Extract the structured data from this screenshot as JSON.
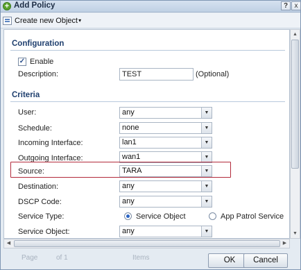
{
  "window": {
    "title": "Add Policy",
    "help_label": "?",
    "close_label": "x"
  },
  "toolbar": {
    "create_label": "Create new Object",
    "create_caret": "▾"
  },
  "configuration": {
    "title": "Configuration",
    "enable_label": "Enable",
    "enable_checked": true,
    "description_label": "Description:",
    "description_value": "TEST",
    "optional_label": "(Optional)"
  },
  "criteria": {
    "title": "Criteria",
    "rows": [
      {
        "label": "User:",
        "value": "any"
      },
      {
        "label": "Schedule:",
        "value": "none"
      },
      {
        "label": "Incoming Interface:",
        "value": "lan1"
      },
      {
        "label": "Outgoing Interface:",
        "value": "wan1"
      },
      {
        "label": "Source:",
        "value": "TARA"
      },
      {
        "label": "Destination:",
        "value": "any"
      },
      {
        "label": "DSCP Code:",
        "value": "any"
      }
    ],
    "service_type_label": "Service Type:",
    "service_type_options": [
      "Service Object",
      "App Patrol Service"
    ],
    "service_type_selected": "Service Object",
    "service_object_label": "Service Object:",
    "service_object_value": "any"
  },
  "footer": {
    "ok_label": "OK",
    "cancel_label": "Cancel",
    "ghost_items": [
      "Page",
      "of 1",
      "Items"
    ]
  },
  "colors": {
    "accent": "#1f3f6e",
    "highlight_border": "#b2293a"
  }
}
